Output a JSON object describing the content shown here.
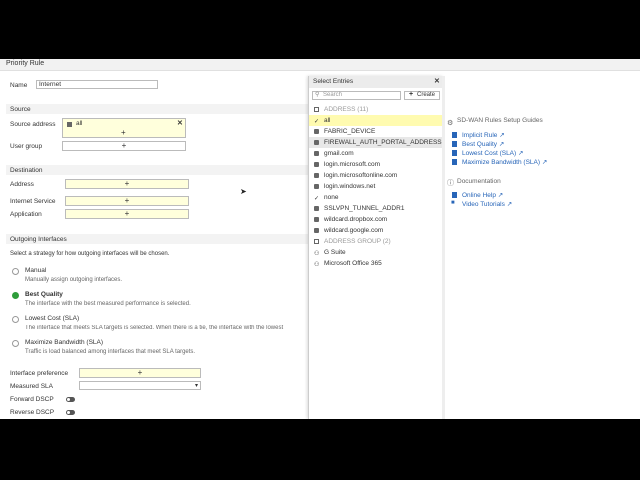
{
  "page": {
    "title": "Priority Rule"
  },
  "form": {
    "name_label": "Name",
    "name_value": "Internet",
    "source_section": "Source",
    "source_address_label": "Source address",
    "source_address_value": "all",
    "user_group_label": "User group",
    "destination_section": "Destination",
    "address_label": "Address",
    "internet_service_label": "Internet Service",
    "application_label": "Application",
    "outgoing_section": "Outgoing Interfaces",
    "strategy_prompt": "Select a strategy for how outgoing interfaces will be chosen.",
    "strategies": [
      {
        "title": "Manual",
        "desc": "Manually assign outgoing interfaces.",
        "selected": false
      },
      {
        "title": "Best Quality",
        "desc": "The interface with the best measured performance is selected.",
        "selected": true
      },
      {
        "title": "Lowest Cost (SLA)",
        "desc": "The interface that meets SLA targets is selected. When there is a tie, the interface with the lowest",
        "selected": false
      },
      {
        "title": "Maximize Bandwidth (SLA)",
        "desc": "Traffic is load balanced among interfaces that meet SLA targets.",
        "selected": false
      }
    ],
    "interface_preference_label": "Interface preference",
    "measured_sla_label": "Measured SLA",
    "forward_dscp_label": "Forward DSCP",
    "reverse_dscp_label": "Reverse DSCP",
    "plus": "+"
  },
  "popup": {
    "title": "Select Entries",
    "close": "✕",
    "search_placeholder": "Search",
    "create_label": "Create",
    "create_plus": "+",
    "address_group_header": "ADDRESS (11)",
    "entries": [
      "all",
      "FABRIC_DEVICE",
      "FIREWALL_AUTH_PORTAL_ADDRESS",
      "gmail.com",
      "login.microsoft.com",
      "login.microsoftonline.com",
      "login.windows.net",
      "none",
      "SSLVPN_TUNNEL_ADDR1",
      "wildcard.dropbox.com",
      "wildcard.google.com"
    ],
    "addrgrp_header": "ADDRESS GROUP (2)",
    "groups": [
      "G Suite",
      "Microsoft Office 365"
    ]
  },
  "help": {
    "guides_title": "SD-WAN Rules Setup Guides",
    "guides": [
      "Implicit Rule",
      "Best Quality",
      "Lowest Cost (SLA)",
      "Maximize Bandwidth (SLA)"
    ],
    "doc_title": "Documentation",
    "docs": [
      "Online Help",
      "Video Tutorials"
    ]
  },
  "colors": {
    "selected_bg": "#ffffdc",
    "radio_on": "#2e9d3a",
    "link": "#2765b8"
  }
}
